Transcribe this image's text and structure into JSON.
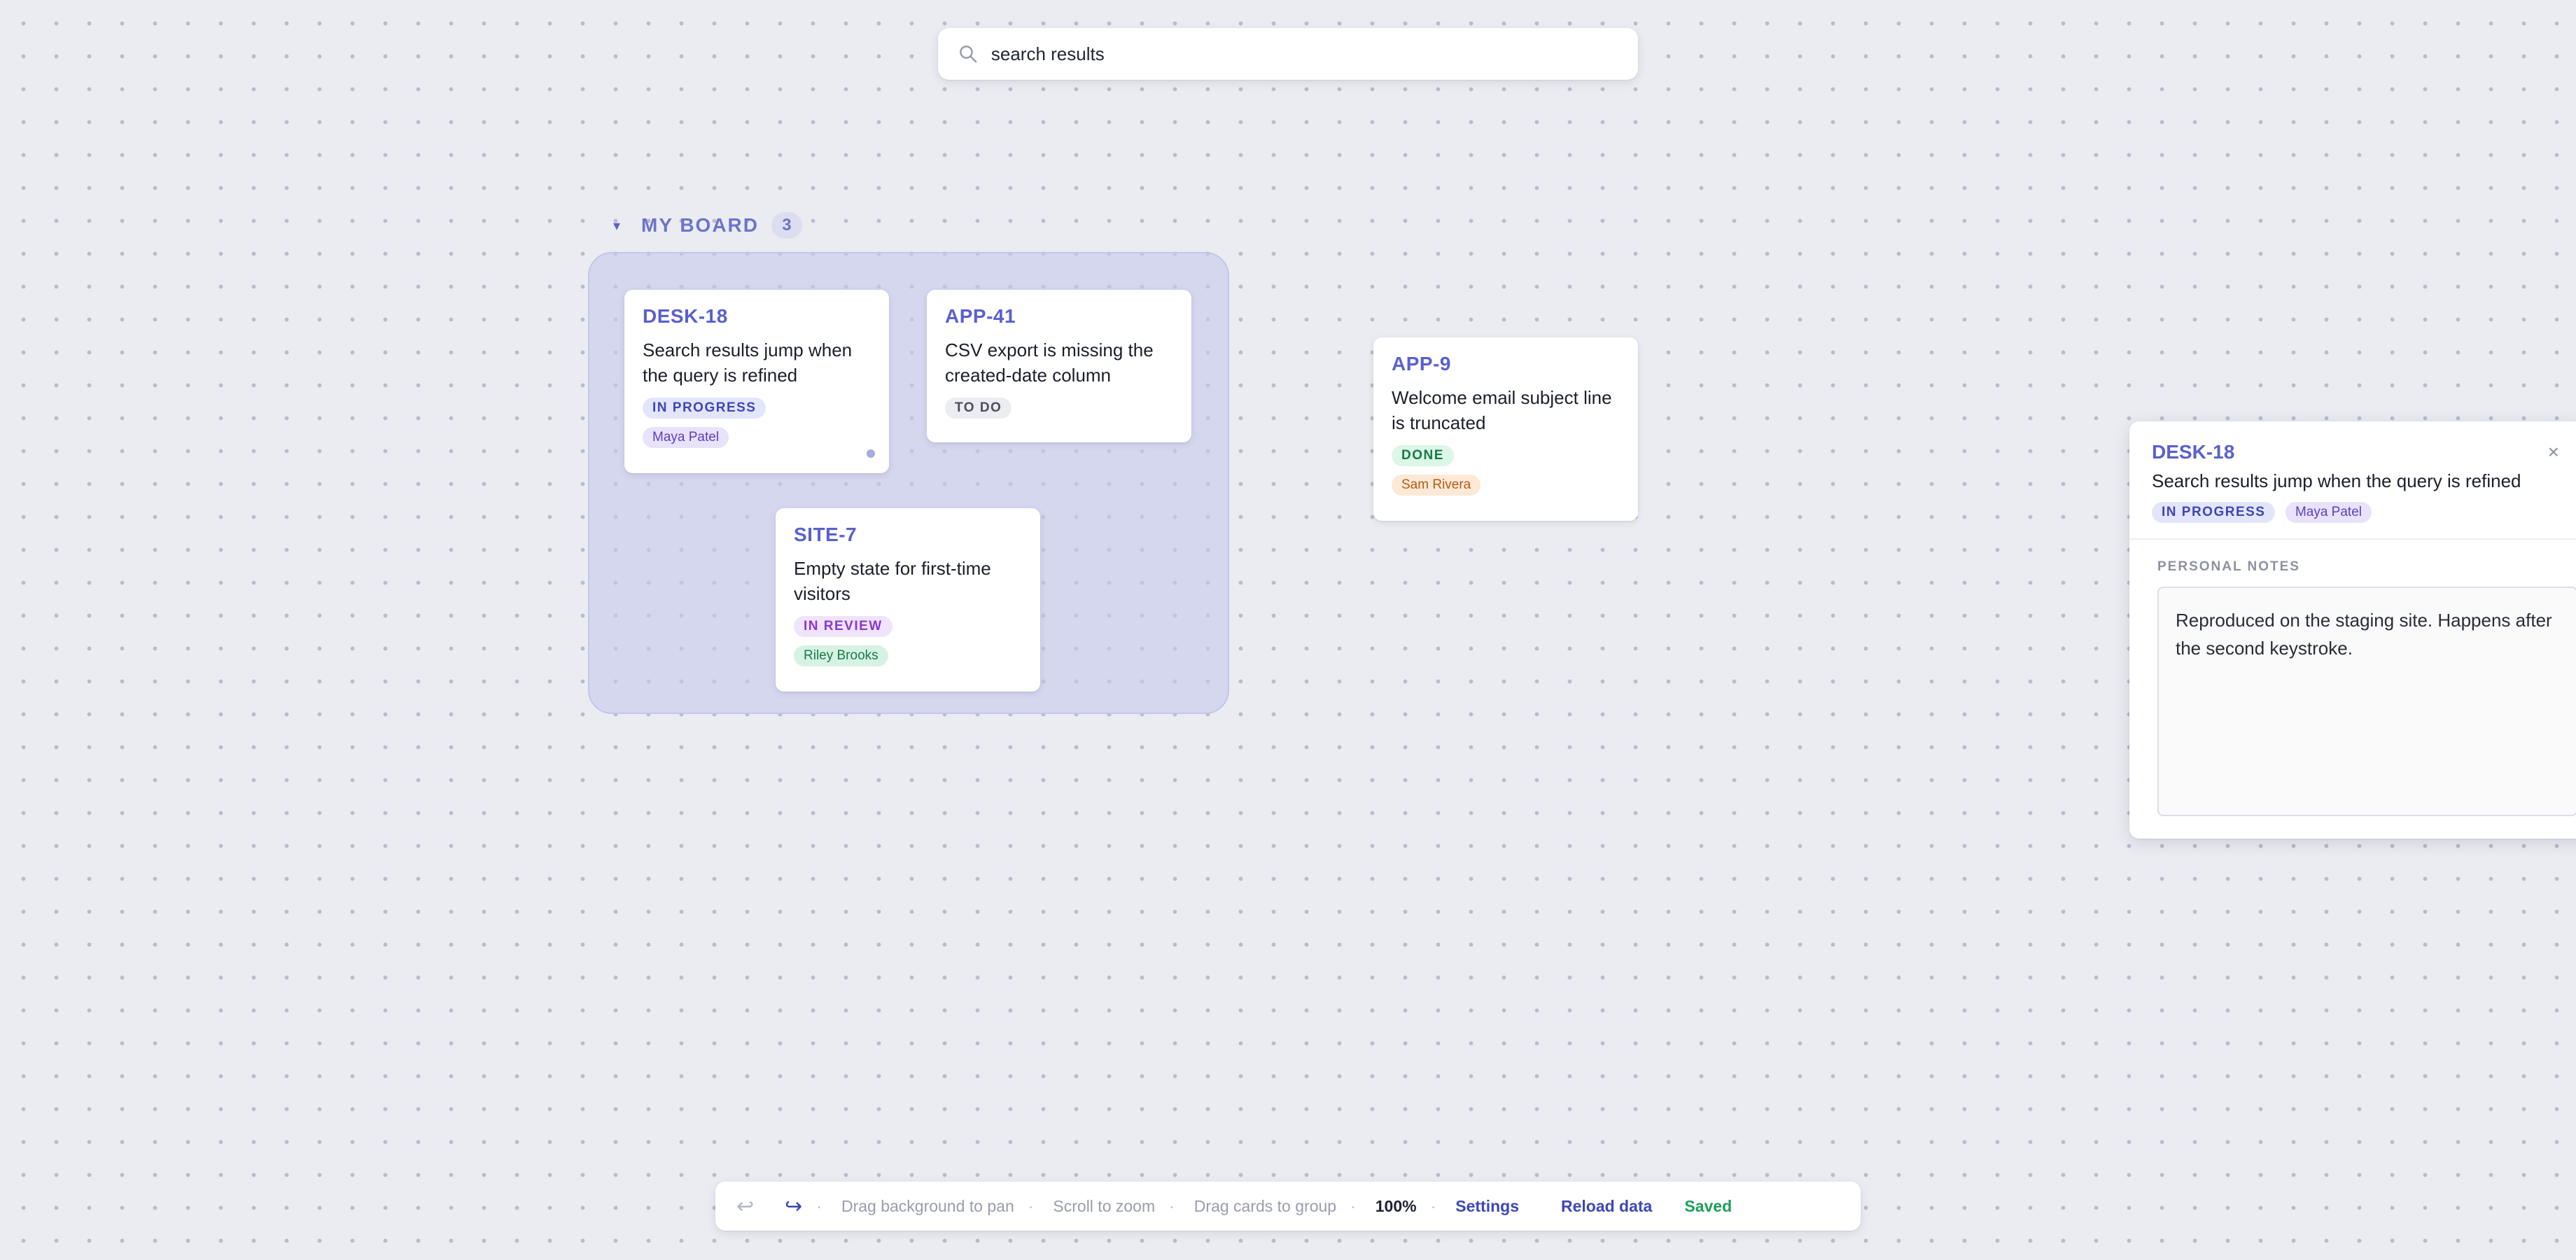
{
  "search": {
    "value": "search results"
  },
  "group": {
    "title": "MY BOARD",
    "count": "3",
    "caret": "▾"
  },
  "cards": {
    "desk18": {
      "key": "DESK-18",
      "summary": "Search results jump when the query is refined",
      "status": "IN PROGRESS",
      "assignee": "Maya Patel"
    },
    "app41": {
      "key": "APP-41",
      "summary": "CSV export is missing the created-date column",
      "status": "TO DO"
    },
    "site7": {
      "key": "SITE-7",
      "summary": "Empty state for first-time visitors",
      "status": "IN REVIEW",
      "assignee": "Riley Brooks"
    },
    "app9": {
      "key": "APP-9",
      "summary": "Welcome email subject line is truncated",
      "status": "DONE",
      "assignee": "Sam Rivera"
    }
  },
  "panel": {
    "key": "DESK-18",
    "summary": "Search results jump when the query is refined",
    "status": "IN PROGRESS",
    "assignee": "Maya Patel",
    "close": "×",
    "notes_label": "PERSONAL NOTES",
    "notes": "Reproduced on the staging site. Happens after the second keystroke."
  },
  "toolbar": {
    "undo": "↩",
    "redo": "↪",
    "sep": "·",
    "hint_pan": "Drag background to pan",
    "hint_zoom": "Scroll to zoom",
    "hint_group": "Drag cards to group",
    "zoom": "100%",
    "settings": "Settings",
    "reload": "Reload data",
    "saved": "Saved"
  },
  "colors": {
    "accent": "#5960cf",
    "canvas": "#ebecf2",
    "group_fill": "#c8caee",
    "saved": "#1e9e57"
  },
  "icons": {
    "search": "search-icon",
    "caret": "caret-down-icon",
    "close": "close-icon",
    "undo": "undo-icon",
    "redo": "redo-icon",
    "resize": "resize-handle-icon"
  }
}
